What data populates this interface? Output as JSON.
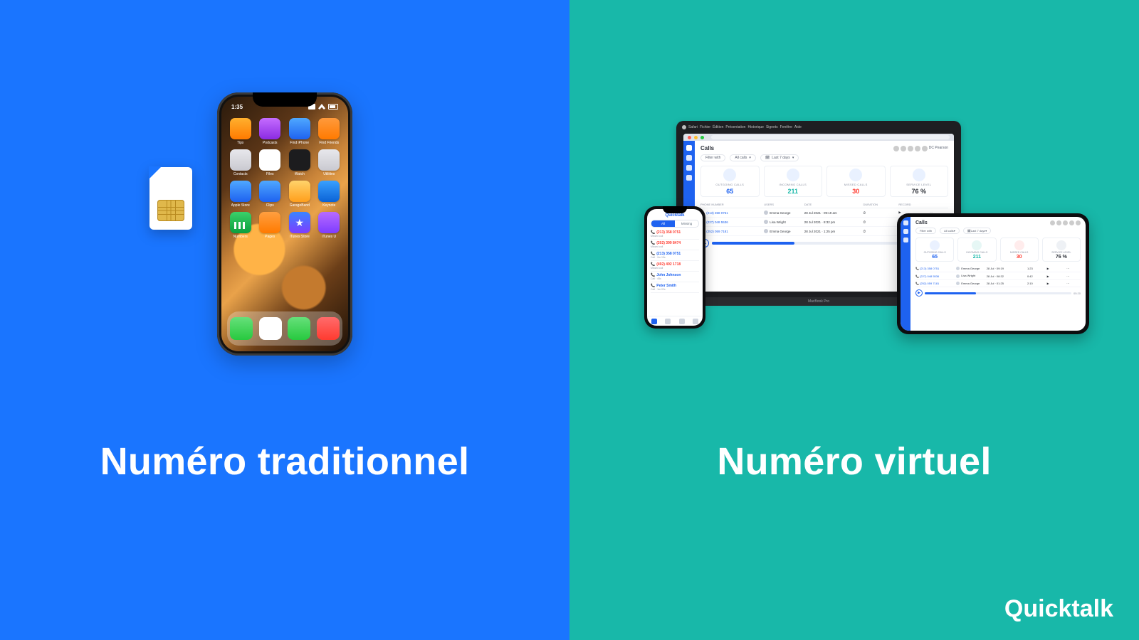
{
  "brand": "Quicktalk",
  "captions": {
    "left": "Numéro traditionnel",
    "right": "Numéro virtuel"
  },
  "colors": {
    "left_bg": "#1a75ff",
    "right_bg": "#18b8a9",
    "text": "#ffffff"
  },
  "iphone": {
    "time": "1:35",
    "icons": {
      "signal": "signal-bars-icon",
      "wifi": "wifi-icon",
      "battery": "battery-icon"
    },
    "apps": [
      {
        "label": "Tips",
        "tile": "t-orange"
      },
      {
        "label": "Podcasts",
        "tile": "t-purple"
      },
      {
        "label": "Find iPhone",
        "tile": "t-blue"
      },
      {
        "label": "Find Friends",
        "tile": "t-orange2"
      },
      {
        "label": "Contacts",
        "tile": "t-gray"
      },
      {
        "label": "Files",
        "tile": "t-white"
      },
      {
        "label": "Watch",
        "tile": "t-dark"
      },
      {
        "label": "Utilities",
        "tile": "t-gray"
      },
      {
        "label": "Apple Store",
        "tile": "t-blue"
      },
      {
        "label": "Clips",
        "tile": "t-blue"
      },
      {
        "label": "GarageBand",
        "tile": "t-gband"
      },
      {
        "label": "Keynote",
        "tile": "t-keynote"
      },
      {
        "label": "Numbers",
        "tile": "t-num"
      },
      {
        "label": "Pages",
        "tile": "t-pages"
      },
      {
        "label": "iTunes Store",
        "tile": "t-star"
      },
      {
        "label": "iTunes U",
        "tile": "t-itunes"
      }
    ],
    "dock": [
      {
        "name": "phone-icon",
        "tile": "t-green"
      },
      {
        "name": "safari-icon",
        "tile": "t-white"
      },
      {
        "name": "messages-icon",
        "tile": "t-green"
      },
      {
        "name": "music-icon",
        "tile": "t-red"
      }
    ]
  },
  "mac": {
    "menubar": [
      "Safari",
      "Fichier",
      "Édition",
      "Présentation",
      "Historique",
      "Signets",
      "Fenêtre",
      "Aide"
    ],
    "strip": "MacBook Pro",
    "app": {
      "title": "Calls",
      "user": "DC Pearson",
      "avatars": 5,
      "filters": {
        "label": "Filter with",
        "type": "All calls",
        "range": "Last 7 days"
      },
      "cards": [
        {
          "label": "OUTGOING CALLS",
          "value": "65",
          "color": "c-blue",
          "bg": "b-blue"
        },
        {
          "label": "INCOMING CALLS",
          "value": "211",
          "color": "c-teal",
          "bg": "b-teal"
        },
        {
          "label": "MISSED CALLS",
          "value": "30",
          "color": "c-red",
          "bg": "b-red"
        },
        {
          "label": "SERVICE LEVEL",
          "value": "76 %",
          "color": "c-dark",
          "bg": "b-gray"
        }
      ],
      "columns": [
        "PHONE NUMBER",
        "USERS",
        "DATE",
        "DURATION",
        "RECORD",
        ""
      ],
      "rows": [
        {
          "phone": "(213) 358 0751",
          "user": "Emma George",
          "date": "28 Jul 2021 · 09:19 am",
          "duration": "⏱",
          "record": "▶",
          "actions": "⋯"
        },
        {
          "phone": "(227) 048 5536",
          "user": "Lisa Wright",
          "date": "28 Jul 2021 · 8:32 pm",
          "duration": "⏱",
          "record": "▶",
          "actions": "⋯"
        },
        {
          "phone": "(252) 059 7181",
          "user": "Emma George",
          "date": "28 Jul 2021 · 1:25 pm",
          "duration": "⏱",
          "record": "▶",
          "actions": "⋯"
        }
      ]
    }
  },
  "mini_phone": {
    "brand": "Quicktalk",
    "segments": [
      "All",
      "Missing"
    ],
    "active_segment": 0,
    "calls": [
      {
        "number": "(213) 358 0751",
        "sub": "Missed call",
        "missed": true
      },
      {
        "number": "(202) 399 8474",
        "sub": "Missed call",
        "missed": true
      },
      {
        "number": "(213) 358 0751",
        "sub": "Call · 2m 15s",
        "missed": false
      },
      {
        "number": "(492) 492 1718",
        "sub": "Missed call",
        "missed": true
      },
      {
        "number": "John Johnson",
        "sub": "Call · 45s",
        "missed": false
      },
      {
        "number": "Peter Smith",
        "sub": "Call · 1m 02s",
        "missed": false
      }
    ],
    "tabs": [
      "keypad",
      "contacts",
      "calls",
      "settings"
    ],
    "active_tab": 0
  },
  "tablet": {
    "title": "Calls",
    "avatars": 5,
    "filters": {
      "label": "Filter with",
      "type": "All calls",
      "range": "Last 7 days"
    },
    "cards": [
      {
        "label": "OUTGOING CALLS",
        "value": "65",
        "color": "c-blue",
        "bg": "b-blue"
      },
      {
        "label": "INCOMING CALLS",
        "value": "211",
        "color": "c-teal",
        "bg": "b-teal"
      },
      {
        "label": "MISSED CALLS",
        "value": "30",
        "color": "c-red",
        "bg": "b-red"
      },
      {
        "label": "SERVICE LEVEL",
        "value": "76 %",
        "color": "c-dark",
        "bg": "b-gray"
      }
    ],
    "rows": [
      {
        "phone": "(213) 358 0751",
        "user": "Emma George",
        "date": "28 Jul · 09:19",
        "dur": "1:23",
        "rec": "▶",
        "act": "⋯"
      },
      {
        "phone": "(227) 048 5536",
        "user": "Lisa Wright",
        "date": "28 Jul · 08:32",
        "dur": "0:42",
        "rec": "▶",
        "act": "⋯"
      },
      {
        "phone": "(252) 059 7181",
        "user": "Emma George",
        "date": "28 Jul · 01:25",
        "dur": "2:10",
        "rec": "▶",
        "act": "⋯"
      }
    ],
    "playback_end": "05:20"
  }
}
